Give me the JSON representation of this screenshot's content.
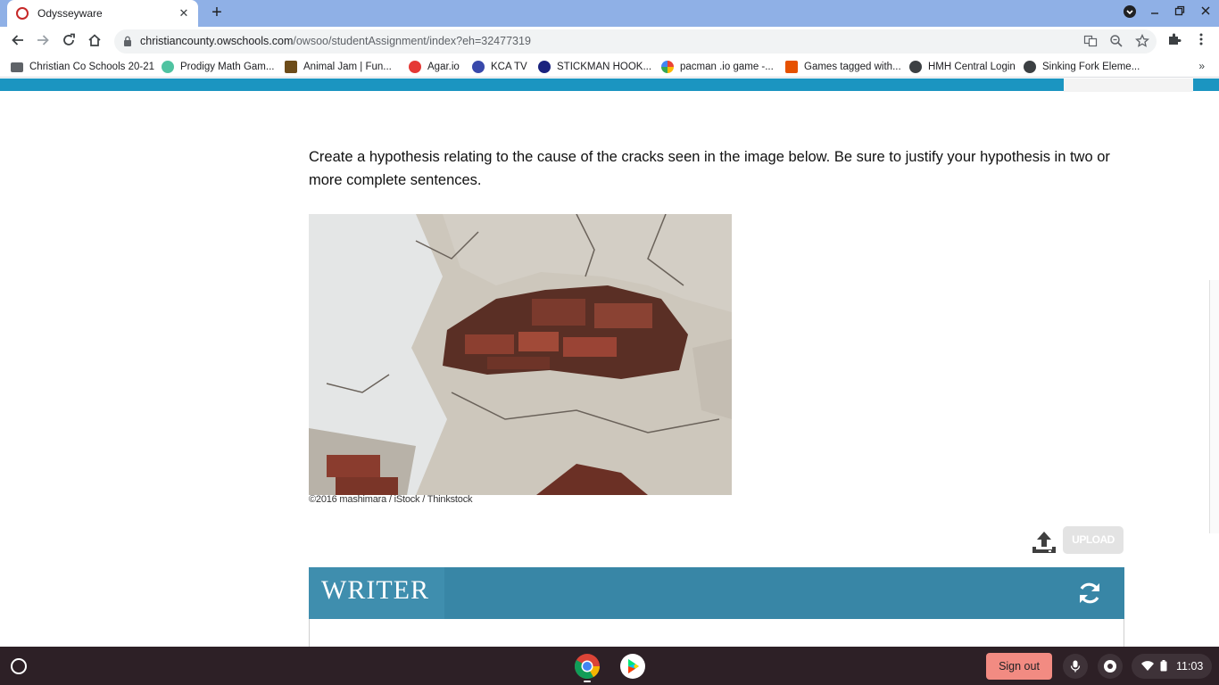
{
  "browser": {
    "tab_title": "Odysseyware",
    "tab_close": "✕",
    "new_tab": "+",
    "url_host": "christiancounty.owschools.com",
    "url_path": "/owsoo/studentAssignment/index?eh=32477319"
  },
  "bookmarks": [
    {
      "label": "Christian Co Schools 20-21",
      "icon": "folder-icon",
      "color": "#5f6368"
    },
    {
      "label": "Prodigy Math Gam...",
      "icon": "prodigy-icon",
      "color": "#4fc3a1"
    },
    {
      "label": "Animal Jam | Fun...",
      "icon": "paw-icon",
      "color": "#6d4c1a"
    },
    {
      "label": "Agar.io",
      "icon": "agar-icon",
      "color": "#e53935"
    },
    {
      "label": "KCA TV",
      "icon": "kca-icon",
      "color": "#3949ab"
    },
    {
      "label": "STICKMAN HOOK...",
      "icon": "stickman-icon",
      "color": "#1a237e"
    },
    {
      "label": "pacman .io game -...",
      "icon": "google-icon",
      "color": "#4285f4"
    },
    {
      "label": "Games tagged with...",
      "icon": "itch-icon",
      "color": "#e65100"
    },
    {
      "label": "HMH Central Login",
      "icon": "globe-icon",
      "color": "#3c4043"
    },
    {
      "label": "Sinking Fork Eleme...",
      "icon": "globe-icon",
      "color": "#3c4043"
    }
  ],
  "bookmarks_more": "»",
  "assignment": {
    "prompt": "Create a hypothesis relating to the cause of the cracks seen in the image below. Be sure to justify your hypothesis in two or more complete sentences.",
    "image_credit": "©2016 mashimara / iStock / Thinkstock",
    "upload_label": "UPLOAD",
    "writer_title": "WRITER"
  },
  "shelf": {
    "sign_out": "Sign out",
    "clock": "11:03"
  },
  "colors": {
    "topbar": "#1b95c1",
    "writer_header": "#3886a6",
    "sign_out": "#f28b82",
    "shelf": "#2d2026"
  }
}
